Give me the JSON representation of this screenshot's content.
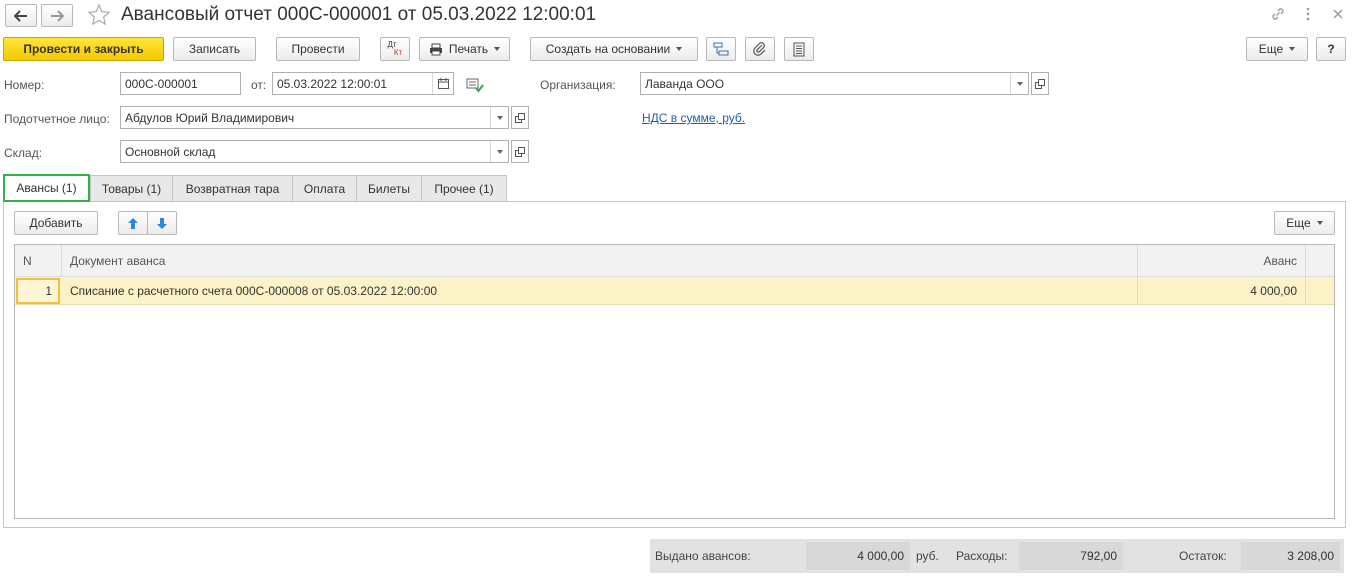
{
  "window": {
    "title": "Авансовый отчет 000С-000001 от 05.03.2022 12:00:01"
  },
  "toolbar": {
    "post_close": "Провести и закрыть",
    "save": "Записать",
    "post": "Провести",
    "dtkt_top": "Дт",
    "dtkt_bottom": "Кт",
    "print": "Печать",
    "create_based": "Создать на основании",
    "more": "Еще",
    "help": "?"
  },
  "form": {
    "number_label": "Номер:",
    "number_value": "000С-000001",
    "date_label": "от:",
    "date_value": "05.03.2022 12:00:01",
    "org_label": "Организация:",
    "org_value": "Лаванда ООО",
    "person_label": "Подотчетное лицо:",
    "person_value": "Абдулов Юрий Владимирович",
    "vat_link": "НДС в сумме, руб.",
    "warehouse_label": "Склад:",
    "warehouse_value": "Основной склад"
  },
  "tabs": [
    {
      "label": "Авансы (1)"
    },
    {
      "label": "Товары (1)"
    },
    {
      "label": "Возвратная тара"
    },
    {
      "label": "Оплата"
    },
    {
      "label": "Билеты"
    },
    {
      "label": "Прочее (1)"
    }
  ],
  "table_toolbar": {
    "add": "Добавить",
    "more": "Еще"
  },
  "table": {
    "columns": [
      "N",
      "Документ аванса",
      "Аванс"
    ],
    "rows": [
      {
        "n": "1",
        "document": "Списание с расчетного счета 000С-000008 от 05.03.2022 12:00:00",
        "advance": "4 000,00"
      }
    ]
  },
  "footer": {
    "issued_label": "Выдано авансов:",
    "issued_value": "4 000,00",
    "currency": "руб.",
    "expenses_label": "Расходы:",
    "expenses_value": "792,00",
    "balance_label": "Остаток:",
    "balance_value": "3 208,00"
  },
  "colors": {
    "primary_button": "#f3c900",
    "active_tab_border": "#2fb24a",
    "selected_row": "#fcf2c7",
    "link": "#1d5fb0"
  }
}
